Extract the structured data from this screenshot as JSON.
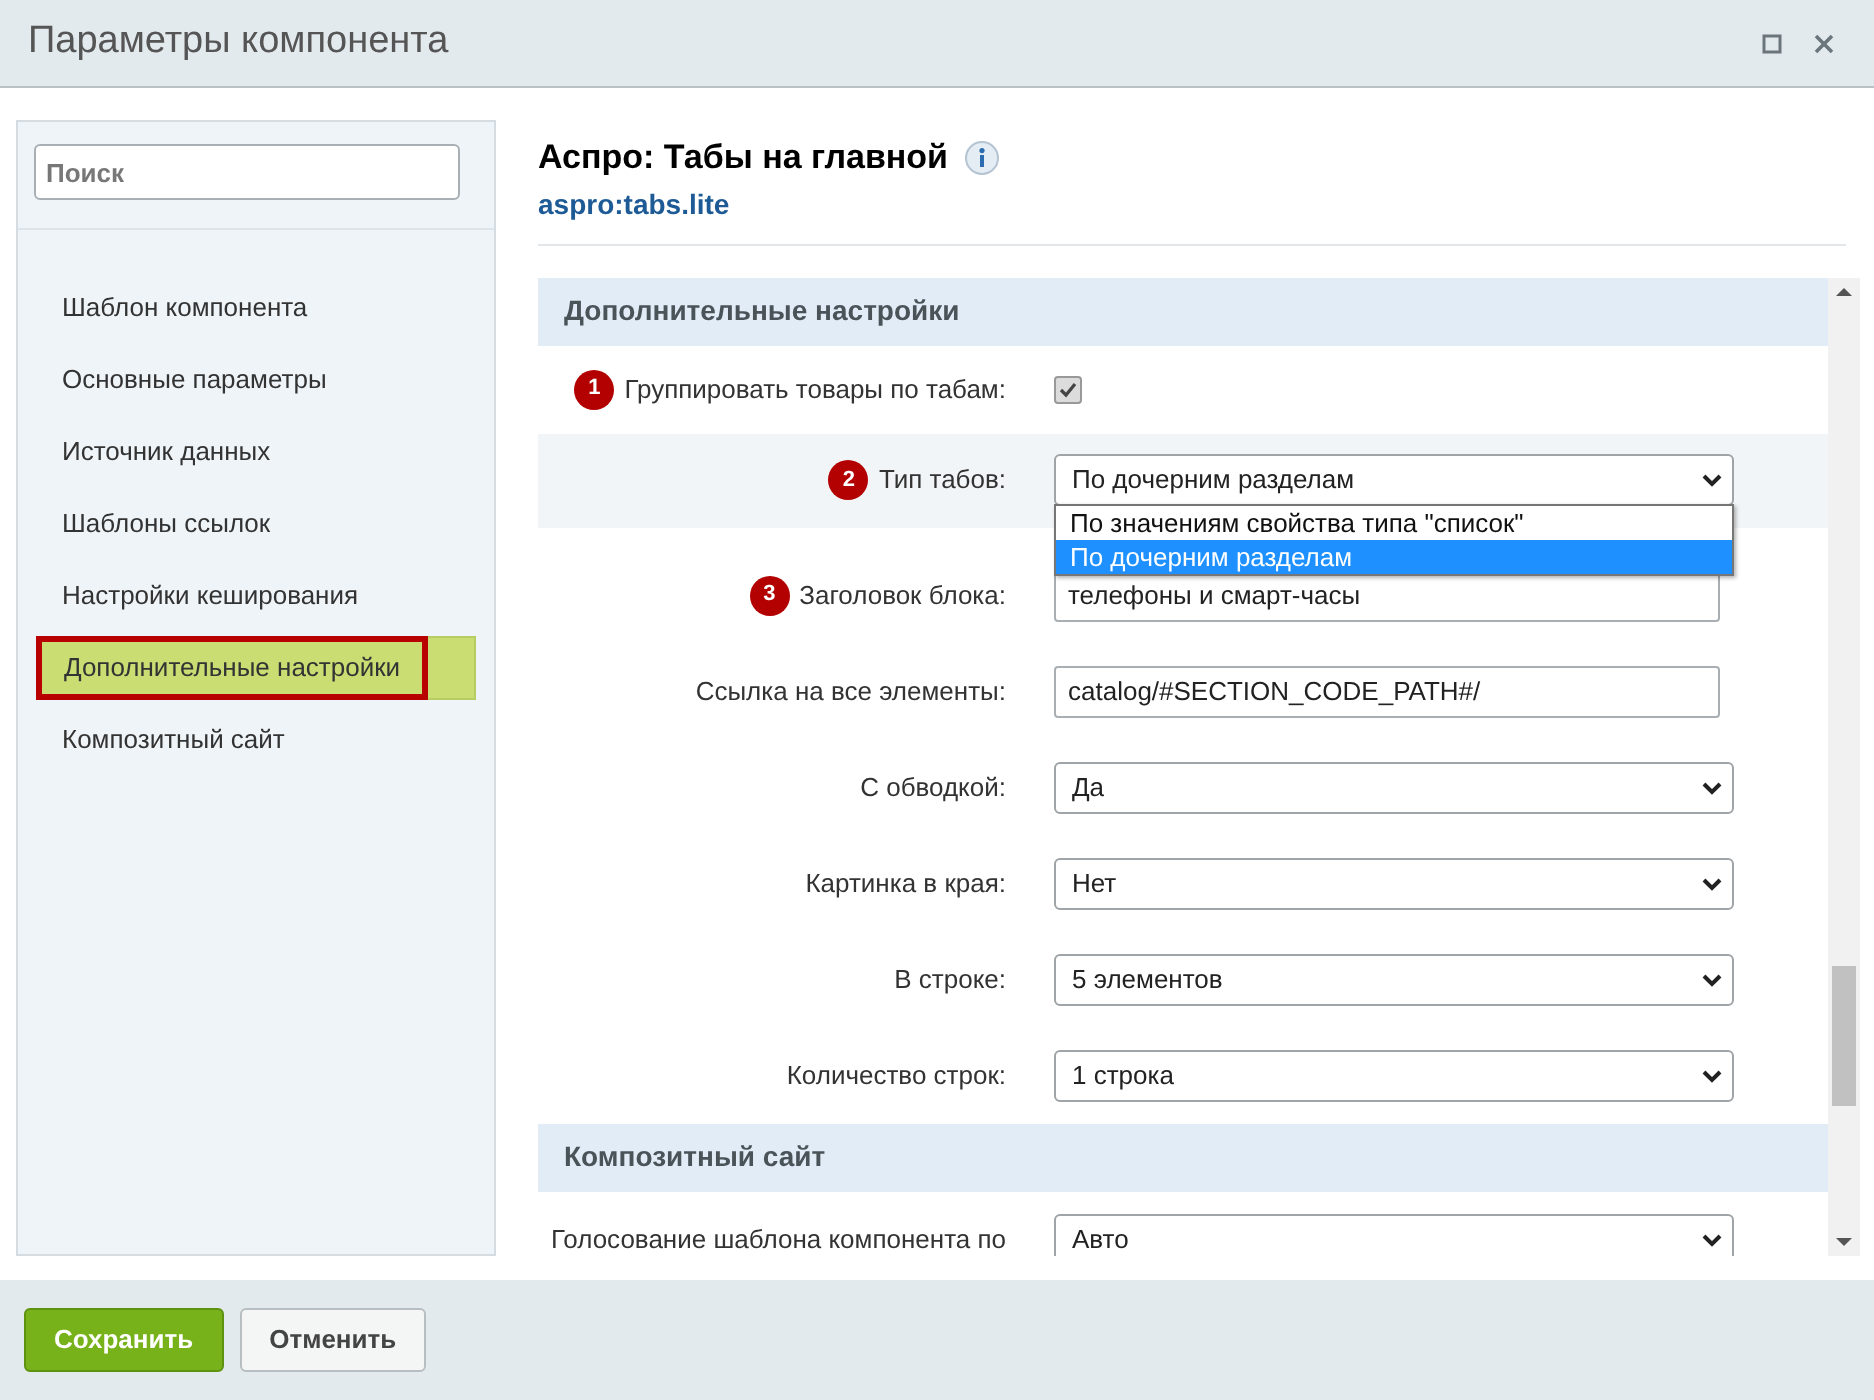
{
  "window": {
    "title": "Параметры компонента"
  },
  "sidebar": {
    "search": {
      "placeholder": "Поиск"
    },
    "items": [
      {
        "label": "Шаблон компонента",
        "selected": false,
        "highlighted": false
      },
      {
        "label": "Основные параметры",
        "selected": false,
        "highlighted": false
      },
      {
        "label": "Источник данных",
        "selected": false,
        "highlighted": false
      },
      {
        "label": "Шаблоны ссылок",
        "selected": false,
        "highlighted": false
      },
      {
        "label": "Настройки кеширования",
        "selected": false,
        "highlighted": false
      },
      {
        "label": "Дополнительные настройки",
        "selected": true,
        "highlighted": true
      },
      {
        "label": "Композитный сайт",
        "selected": false,
        "highlighted": false
      }
    ]
  },
  "component": {
    "title": "Аспро: Табы на главной",
    "code": "aspro:tabs.lite"
  },
  "sections": [
    {
      "title": "Дополнительные настройки",
      "rows": [
        {
          "kind": "checkbox",
          "badge": "1",
          "label": "Группировать товары по табам:",
          "checked": true,
          "highlighted": false
        },
        {
          "kind": "select",
          "badge": "2",
          "label": "Тип табов:",
          "value": "По дочерним разделам",
          "expanded": true,
          "highlighted": true,
          "options": [
            {
              "label": "По значениям свойства типа \"список\"",
              "selected": false
            },
            {
              "label": "По дочерним разделам",
              "selected": true
            }
          ]
        },
        {
          "kind": "input",
          "badge": "3",
          "label": "Заголовок блока:",
          "value": "телефоны и смарт-часы",
          "highlighted": false
        },
        {
          "kind": "input",
          "label": "Ссылка на все элементы:",
          "value": "catalog/#SECTION_CODE_PATH#/",
          "highlighted": false
        },
        {
          "kind": "select",
          "label": "С обводкой:",
          "value": "Да",
          "expanded": false,
          "highlighted": false
        },
        {
          "kind": "select",
          "label": "Картинка в края:",
          "value": "Нет",
          "expanded": false,
          "highlighted": false
        },
        {
          "kind": "select",
          "label": "В строке:",
          "value": "5 элементов",
          "expanded": false,
          "highlighted": false
        },
        {
          "kind": "select",
          "label": "Количество строк:",
          "value": "1 строка",
          "expanded": false,
          "highlighted": false
        }
      ]
    },
    {
      "title": "Композитный сайт",
      "rows": [
        {
          "kind": "select",
          "label": "Голосование шаблона компонента по",
          "value": "Авто",
          "expanded": false,
          "highlighted": false
        }
      ]
    }
  ],
  "footer": {
    "buttons": [
      {
        "label": "Сохранить",
        "kind": "primary"
      },
      {
        "label": "Отменить",
        "kind": "secondary"
      }
    ]
  }
}
